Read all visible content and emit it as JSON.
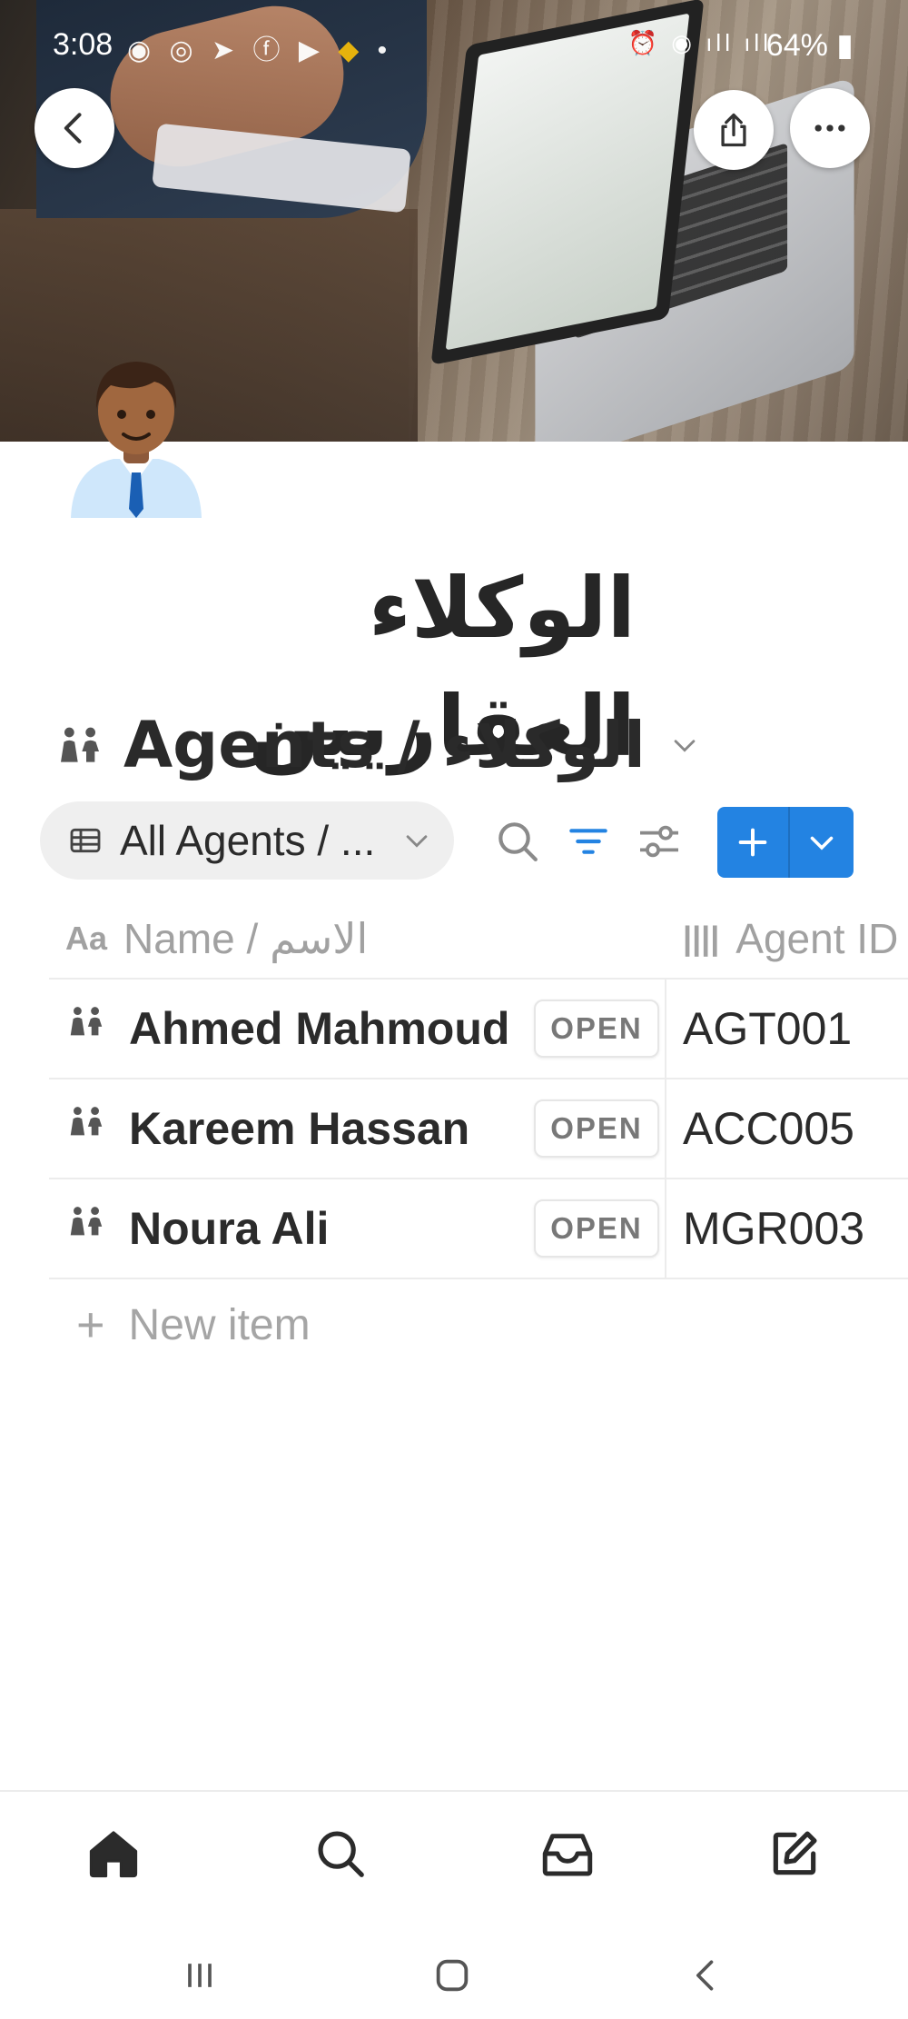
{
  "status_bar": {
    "time": "3:08",
    "battery": "64%",
    "icons": [
      "whatsapp-icon",
      "shield-icon",
      "telegram-icon",
      "facebook-icon",
      "youtube-icon",
      "binance-icon",
      "dot-icon",
      "alarm-icon",
      "hotspot-icon",
      "signal-icon",
      "lte-icon",
      "battery-icon"
    ]
  },
  "header": {
    "back_icon": "chevron-left-icon",
    "share_icon": "share-icon",
    "more_icon": "more-horizontal-icon"
  },
  "page": {
    "avatar_icon": "man-office-worker-emoji",
    "title": "الوكلاء العقاريين"
  },
  "database": {
    "title": "Agents / الوكلاء",
    "icon": "people-icon"
  },
  "view": {
    "label": "All Agents / ...",
    "icon": "table-icon"
  },
  "toolbar": {
    "search_icon": "search-icon",
    "filter_icon": "filter-icon",
    "settings_icon": "sliders-icon",
    "add_icon": "plus-icon",
    "dropdown_icon": "chevron-down-icon",
    "accent": "#2383e2"
  },
  "table": {
    "columns": [
      {
        "icon_text": "Aa",
        "label": "Name / الاسم"
      },
      {
        "icon_text": "||||",
        "label": "Agent ID"
      }
    ],
    "rows": [
      {
        "name": "Ahmed Mahmoud",
        "open": "OPEN",
        "id": "AGT001"
      },
      {
        "name": "Kareem Hassan",
        "open": "OPEN",
        "id": "ACC005"
      },
      {
        "name": "Noura Ali",
        "open": "OPEN",
        "id": "MGR003"
      }
    ],
    "new_item": "New item",
    "new_item_plus": "+"
  },
  "bottom_nav": {
    "items": [
      "home-icon",
      "search-icon",
      "inbox-icon",
      "compose-icon"
    ]
  },
  "system_nav": {
    "items": [
      "recents-icon",
      "home-square-icon",
      "back-icon"
    ]
  }
}
